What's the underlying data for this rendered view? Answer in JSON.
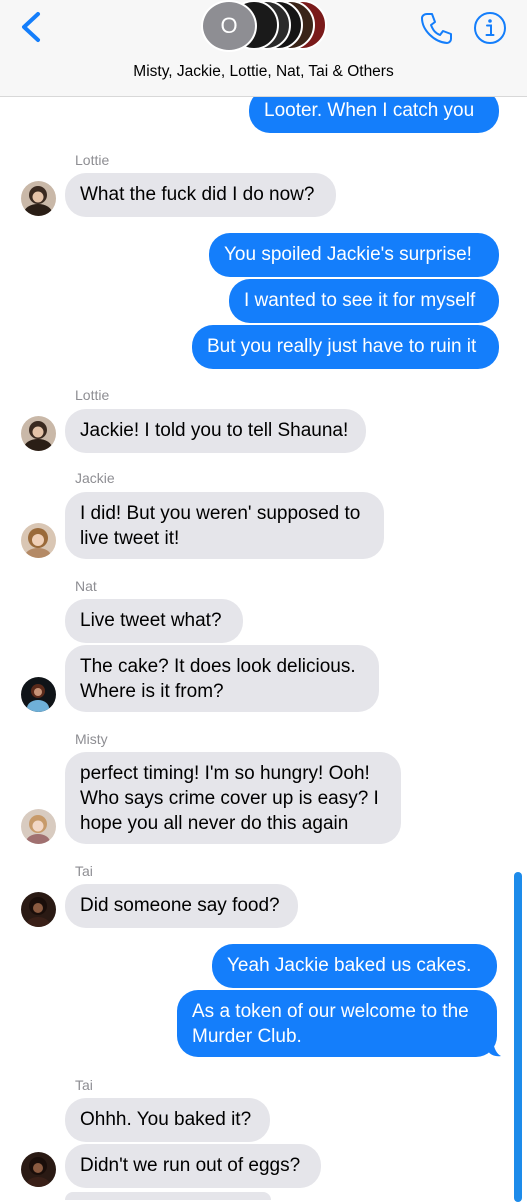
{
  "header": {
    "group_avatar_letter": "O",
    "title": "Misty, Jackie, Lottie, Nat, Tai & Others"
  },
  "messages": [
    {
      "kind": "outgoing",
      "text": "Looter. When I catch you"
    },
    {
      "kind": "sender",
      "text": "Lottie"
    },
    {
      "kind": "incoming",
      "text": "What the fuck did I do now?"
    },
    {
      "kind": "outgoing",
      "text": "You spoiled Jackie's surprise!"
    },
    {
      "kind": "outgoing",
      "text": "I wanted to see it for myself"
    },
    {
      "kind": "outgoing",
      "text": "But you really just have to ruin it"
    },
    {
      "kind": "sender",
      "text": "Lottie"
    },
    {
      "kind": "incoming",
      "text": "Jackie! I told you to tell Shauna!"
    },
    {
      "kind": "sender",
      "text": "Jackie"
    },
    {
      "kind": "incoming",
      "lines": [
        "I did! But you weren' supposed to",
        "live tweet it!"
      ]
    },
    {
      "kind": "sender",
      "text": "Nat"
    },
    {
      "kind": "incoming",
      "text": "Live tweet what?"
    },
    {
      "kind": "incoming",
      "lines": [
        "The cake? It does look delicious.",
        "Where is it from?"
      ]
    },
    {
      "kind": "sender",
      "text": "Misty"
    },
    {
      "kind": "incoming",
      "lines": [
        "perfect timing! I'm so hungry! Ooh!",
        "Who says crime cover up is easy? I",
        "hope you all never do this again"
      ]
    },
    {
      "kind": "sender",
      "text": "Tai"
    },
    {
      "kind": "incoming",
      "text": "Did someone say food?"
    },
    {
      "kind": "outgoing",
      "text": "Yeah Jackie baked us cakes."
    },
    {
      "kind": "outgoing",
      "lines": [
        "As a token of our welcome to the",
        "Murder Club."
      ]
    },
    {
      "kind": "sender",
      "text": "Tai"
    },
    {
      "kind": "incoming",
      "text": "Ohhh. You baked it?"
    },
    {
      "kind": "incoming",
      "text": "Didn't we run out of eggs?"
    }
  ],
  "colors": {
    "outgoing_bubble": "#147efb",
    "incoming_bubble": "#e5e5ea",
    "accent": "#147efb",
    "sender_name": "#8e8e93"
  },
  "icons": {
    "back": "chevron-left-icon",
    "call": "phone-icon",
    "info": "info-icon"
  }
}
